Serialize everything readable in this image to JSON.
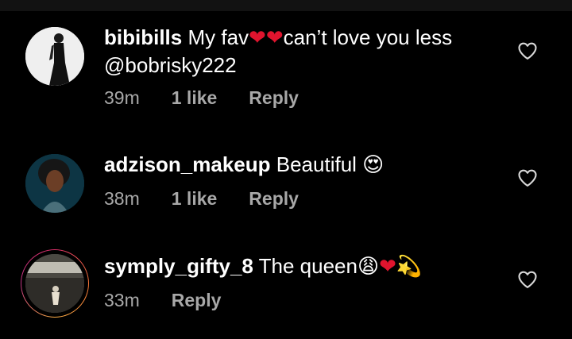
{
  "comments": [
    {
      "username": "bibibills",
      "text_part1": "My fav",
      "hearts": "❤❤",
      "text_part2": "can’t love you less",
      "mention": "@bobrisky222",
      "time": "39m",
      "likes": "1 like",
      "reply": "Reply",
      "avatar_icon": "avatar-photo-woman-standing"
    },
    {
      "username": "adzison_makeup",
      "text": "Beautiful",
      "emoji": "😍",
      "time": "38m",
      "likes": "1 like",
      "reply": "Reply",
      "avatar_icon": "avatar-photo-woman-portrait"
    },
    {
      "username": "symply_gifty_8",
      "text": "The queen",
      "emoji1": "😩",
      "emoji2": "❤",
      "emoji3": "💫",
      "time": "33m",
      "reply": "Reply",
      "avatar_icon": "avatar-photo-stage-story-ring"
    }
  ],
  "colors": {
    "background": "#000000",
    "text": "#ffffff",
    "meta": "#a8a8a8",
    "heart": "#e0142e"
  },
  "icons": {
    "like": "heart-outline-icon"
  }
}
